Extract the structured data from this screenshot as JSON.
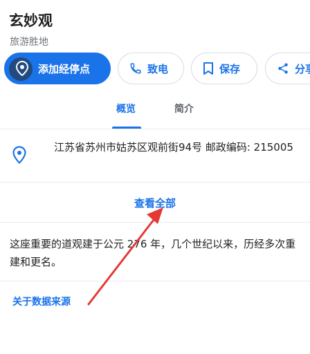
{
  "place": {
    "name": "玄妙观",
    "category": "旅游胜地"
  },
  "actions": {
    "add_stop": "添加经停点",
    "call": "致电",
    "save": "保存",
    "share": "分享"
  },
  "tabs": [
    {
      "label": "概览",
      "selected": true
    },
    {
      "label": "简介",
      "selected": false
    }
  ],
  "address": "江苏省苏州市姑苏区观前街94号 邮政编码: 215005",
  "view_all": "查看全部",
  "description": "这座重要的道观建于公元 276 年，几个世纪以来，历经多次重建和更名。",
  "data_source_link": "关于数据来源",
  "colors": {
    "accent": "#1a73e8",
    "annotation_arrow": "#e53935"
  },
  "icons": {
    "add_stop": "pin-plus-icon",
    "call": "phone-icon",
    "save": "bookmark-icon",
    "share": "share-icon",
    "address": "location-pin-icon"
  }
}
